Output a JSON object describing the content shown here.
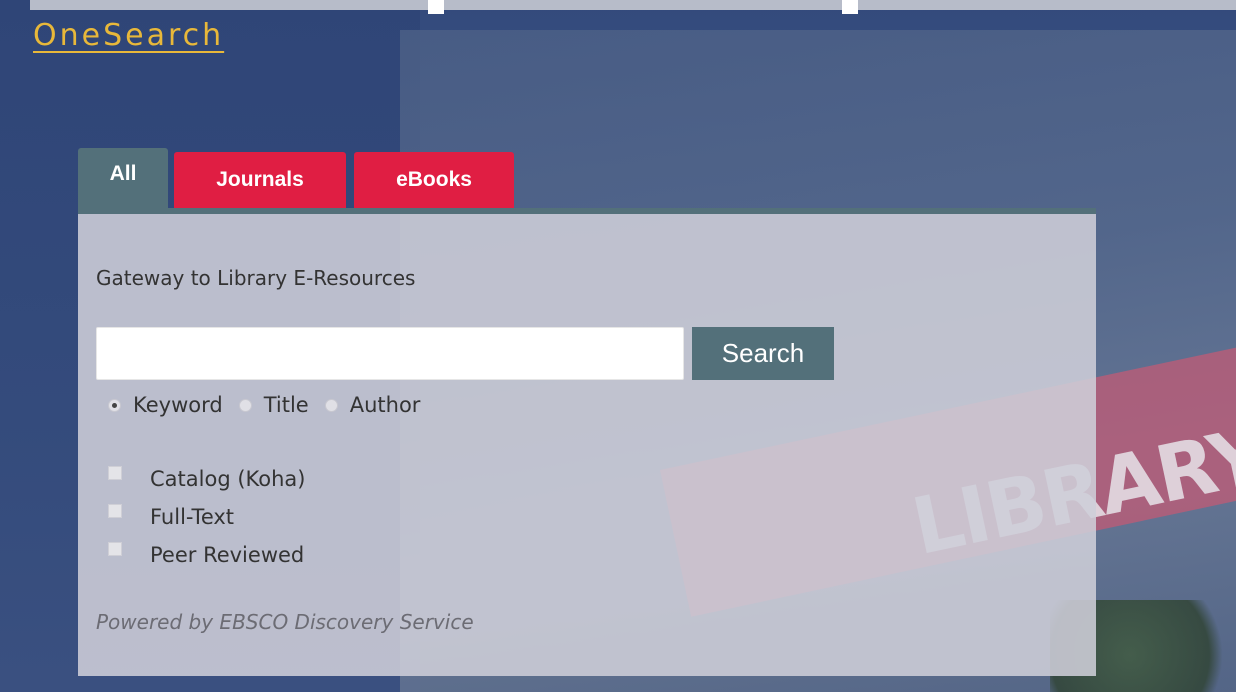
{
  "brand": {
    "title": "OneSearch",
    "color": "#e8b83a"
  },
  "tabs": [
    {
      "label": "All",
      "active": true,
      "color": "#53707a"
    },
    {
      "label": "Journals",
      "active": false,
      "color": "#e01e43"
    },
    {
      "label": "eBooks",
      "active": false,
      "color": "#e01e43"
    }
  ],
  "panel": {
    "heading": "Gateway to Library E-Resources",
    "search": {
      "value": "",
      "placeholder": "",
      "button_label": "Search"
    },
    "search_types": [
      {
        "label": "Keyword",
        "checked": true
      },
      {
        "label": "Title",
        "checked": false
      },
      {
        "label": "Author",
        "checked": false
      }
    ],
    "limiters": [
      {
        "label": "Catalog (Koha)",
        "checked": false
      },
      {
        "label": "Full-Text",
        "checked": false
      },
      {
        "label": "Peer Reviewed",
        "checked": false
      }
    ],
    "footer": "Powered by EBSCO Discovery Service"
  },
  "background": {
    "sign_text": "LIBRARY"
  }
}
